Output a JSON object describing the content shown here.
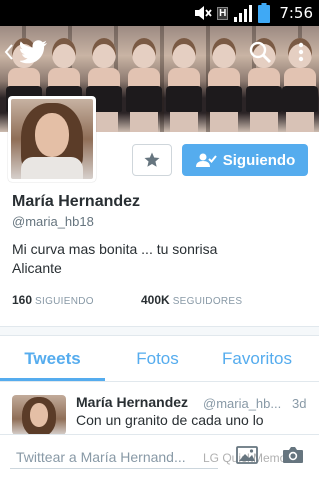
{
  "status_bar": {
    "time": "7:56",
    "network_letter": "H"
  },
  "profile": {
    "name": "María Hernandez",
    "handle": "@maria_hb18",
    "bio_line1": "Mi curva mas bonita ... tu sonrisa",
    "bio_line2": "Alicante",
    "following_count": "160",
    "following_label": "SIGUIENDO",
    "followers_count": "400K",
    "followers_label": "SEGUIDORES"
  },
  "actions": {
    "follow_label": "Siguiendo"
  },
  "tabs": [
    {
      "label": "Tweets",
      "active": true
    },
    {
      "label": "Fotos",
      "active": false
    },
    {
      "label": "Favoritos",
      "active": false
    }
  ],
  "tweet": {
    "name": "María Hernandez",
    "handle": "@maria_hb...",
    "time": "3d",
    "text": "Con un granito de cada uno lo"
  },
  "compose": {
    "placeholder": "Twittear a María Hernand..."
  },
  "watermark": "LG QuickMemo",
  "icons": [
    "back-icon",
    "twitter-bird-icon",
    "search-icon",
    "more-icon",
    "star-icon",
    "follow-user-icon",
    "photo-icon",
    "camera-icon",
    "mute-icon",
    "signal-icon",
    "battery-icon"
  ],
  "colors": {
    "accent": "#55acee",
    "text": "#292f33",
    "muted": "#8899a6"
  }
}
